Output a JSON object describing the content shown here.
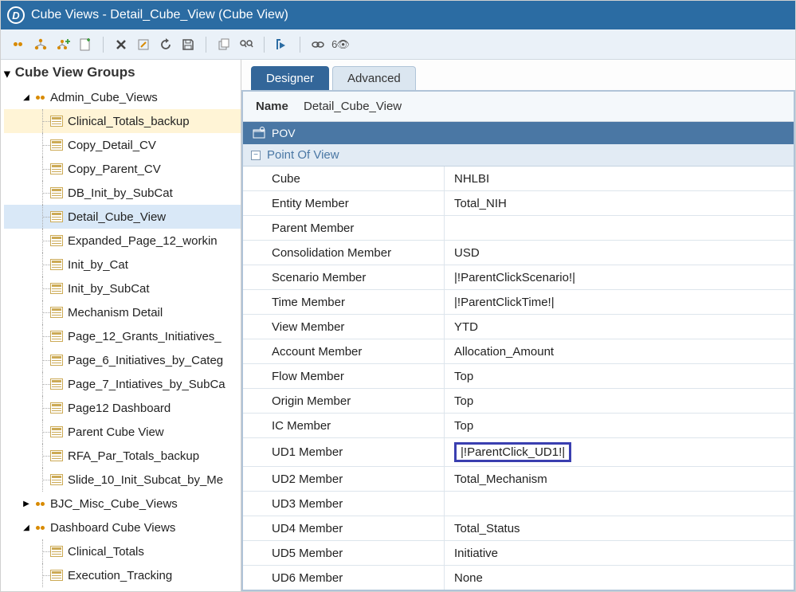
{
  "title": "Cube Views - Detail_Cube_View (Cube View)",
  "tree_header": "Cube View Groups",
  "groups": [
    {
      "label": "Admin_Cube_Views",
      "expanded": true
    },
    {
      "label": "BJC_Misc_Cube_Views",
      "expanded": false
    },
    {
      "label": "Dashboard Cube Views",
      "expanded": true
    }
  ],
  "admin_items": [
    "Clinical_Totals_backup",
    "Copy_Detail_CV",
    "Copy_Parent_CV",
    "DB_Init_by_SubCat",
    "Detail_Cube_View",
    "Expanded_Page_12_workin",
    "Init_by_Cat",
    "Init_by_SubCat",
    "Mechanism Detail",
    "Page_12_Grants_Initiatives_",
    "Page_6_Initiatives_by_Categ",
    "Page_7_Intiatives_by_SubCa",
    "Page12 Dashboard",
    "Parent Cube View",
    "RFA_Par_Totals_backup",
    "Slide_10_Init_Subcat_by_Me"
  ],
  "dashboard_items": [
    "Clinical_Totals",
    "Execution_Tracking"
  ],
  "tabs": {
    "designer": "Designer",
    "advanced": "Advanced"
  },
  "name_label": "Name",
  "name_value": "Detail_Cube_View",
  "pov_header": "POV",
  "pov_section": "Point Of View",
  "props": [
    {
      "label": "Cube",
      "value": "NHLBI"
    },
    {
      "label": "Entity Member",
      "value": "Total_NIH"
    },
    {
      "label": "Parent Member",
      "value": ""
    },
    {
      "label": "Consolidation Member",
      "value": "USD"
    },
    {
      "label": "Scenario Member",
      "value": "|!ParentClickScenario!|"
    },
    {
      "label": "Time Member",
      "value": "|!ParentClickTime!|"
    },
    {
      "label": "View Member",
      "value": "YTD"
    },
    {
      "label": "Account Member",
      "value": "Allocation_Amount"
    },
    {
      "label": "Flow Member",
      "value": "Top"
    },
    {
      "label": "Origin Member",
      "value": "Top"
    },
    {
      "label": "IC Member",
      "value": "Top"
    },
    {
      "label": "UD1 Member",
      "value": "|!ParentClick_UD1!|",
      "highlight": true
    },
    {
      "label": "UD2 Member",
      "value": "Total_Mechanism"
    },
    {
      "label": "UD3 Member",
      "value": ""
    },
    {
      "label": "UD4 Member",
      "value": "Total_Status"
    },
    {
      "label": "UD5 Member",
      "value": "Initiative"
    },
    {
      "label": "UD6 Member",
      "value": "None"
    }
  ]
}
